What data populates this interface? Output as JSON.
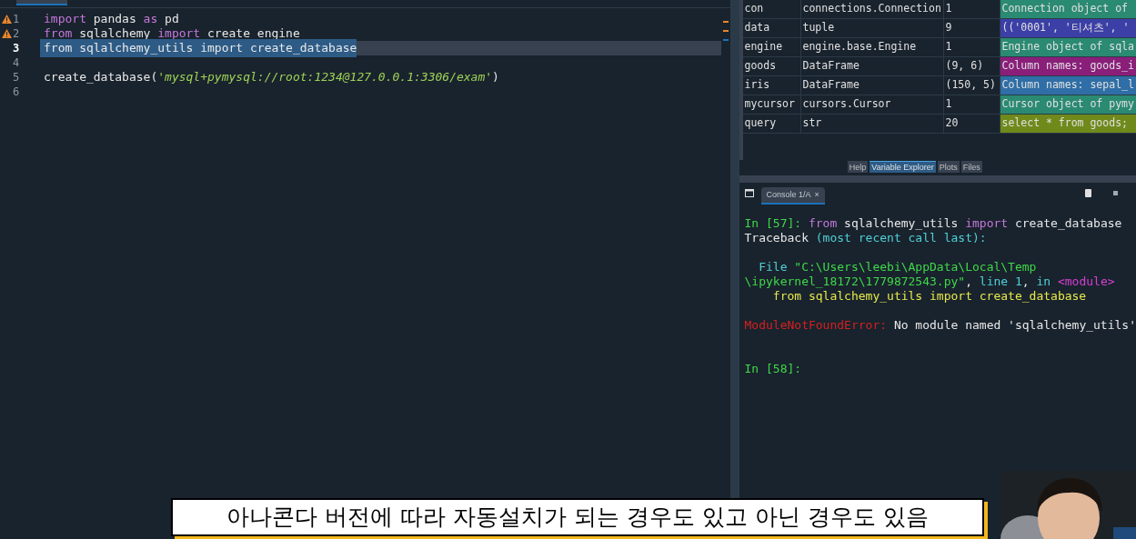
{
  "editor": {
    "lines": [
      {
        "number": "1",
        "warning": true,
        "selected": false,
        "tokens": [
          {
            "kind": "keyword",
            "text": "import"
          },
          {
            "kind": "plain",
            "text": " pandas "
          },
          {
            "kind": "keyword",
            "text": "as"
          },
          {
            "kind": "plain",
            "text": " pd"
          }
        ]
      },
      {
        "number": "2",
        "warning": true,
        "selected": false,
        "tokens": [
          {
            "kind": "keyword",
            "text": "from"
          },
          {
            "kind": "plain",
            "text": " sqlalchemy "
          },
          {
            "kind": "keyword",
            "text": "import"
          },
          {
            "kind": "plain",
            "text": " create_engine"
          }
        ]
      },
      {
        "number": "3",
        "warning": false,
        "selected": true,
        "tokens": [
          {
            "kind": "plain",
            "text": "from sqlalchemy_utils import create_database"
          }
        ]
      },
      {
        "number": "4",
        "warning": false,
        "selected": false
      },
      {
        "number": "5",
        "warning": false,
        "selected": false,
        "tokens": [
          {
            "kind": "plain",
            "text": "create_database("
          },
          {
            "kind": "string",
            "text": "'mysql+pymysql://root:1234@127.0.0.1:3306/exam'"
          },
          {
            "kind": "plain",
            "text": ")"
          }
        ]
      },
      {
        "number": "6",
        "warning": false,
        "selected": false
      }
    ]
  },
  "variables": [
    {
      "name": "con",
      "type": "connections.Connection",
      "size": "1",
      "value": "Connection object of",
      "color": "#2a8a72"
    },
    {
      "name": "data",
      "type": "tuple",
      "size": "9",
      "value": "(('0001', '티셔츠', '",
      "color": "#3b3fa6"
    },
    {
      "name": "engine",
      "type": "engine.base.Engine",
      "size": "1",
      "value": "Engine object of sqla",
      "color": "#2a8a72"
    },
    {
      "name": "goods",
      "type": "DataFrame",
      "size": "(9, 6)",
      "value": "Column names: goods_i",
      "color": "#8a1f7a"
    },
    {
      "name": "iris",
      "type": "DataFrame",
      "size": "(150, 5)",
      "value": "Column names: sepal_l",
      "color": "#2f6ea6"
    },
    {
      "name": "mycursor",
      "type": "cursors.Cursor",
      "size": "1",
      "value": "Cursor object of pymy",
      "color": "#2a8a72"
    },
    {
      "name": "query",
      "type": "str",
      "size": "20",
      "value": "select * from goods;",
      "color": "#6f8a1a"
    }
  ],
  "pane_tabs": [
    {
      "label": "Help",
      "selected": false
    },
    {
      "label": "Variable Explorer",
      "selected": true
    },
    {
      "label": "Plots",
      "selected": false
    },
    {
      "label": "Files",
      "selected": false
    }
  ],
  "console": {
    "tab": "Console 1/A",
    "close": "×",
    "lines": [
      {
        "kind": "text",
        "tokens": [
          {
            "kind": "prompt",
            "text": "In [57]: "
          },
          {
            "kind": "keyword",
            "text": "from"
          },
          {
            "kind": "plain",
            "text": " sqlalchemy_utils "
          },
          {
            "kind": "keyword",
            "text": "import"
          },
          {
            "kind": "plain",
            "text": " create_database"
          }
        ]
      },
      {
        "kind": "text",
        "tokens": [
          {
            "kind": "plain",
            "text": "Traceback "
          },
          {
            "kind": "cyan",
            "text": "(most recent call last):"
          }
        ]
      },
      {
        "kind": "blank"
      },
      {
        "kind": "text",
        "tokens": [
          {
            "kind": "cyan",
            "text": "  File "
          },
          {
            "kind": "green",
            "text": "\"C:\\Users\\leebi\\AppData\\Local\\Temp"
          }
        ]
      },
      {
        "kind": "text",
        "tokens": [
          {
            "kind": "green",
            "text": "\\ipykernel_18172\\1779872543.py\""
          },
          {
            "kind": "plain",
            "text": ", "
          },
          {
            "kind": "cyan",
            "text": "line 1"
          },
          {
            "kind": "plain",
            "text": ", "
          },
          {
            "kind": "cyan",
            "text": "in "
          },
          {
            "kind": "magenta",
            "text": "<module>"
          }
        ]
      },
      {
        "kind": "text",
        "tokens": [
          {
            "kind": "yellow",
            "text": "    from sqlalchemy_utils import create_database"
          }
        ]
      },
      {
        "kind": "blank"
      },
      {
        "kind": "text",
        "tokens": [
          {
            "kind": "error",
            "text": "ModuleNotFoundError:"
          },
          {
            "kind": "plain",
            "text": " No module named 'sqlalchemy_utils'"
          }
        ]
      },
      {
        "kind": "blank"
      },
      {
        "kind": "blank"
      },
      {
        "kind": "text",
        "tokens": [
          {
            "kind": "prompt",
            "text": "In [58]:"
          }
        ]
      }
    ]
  },
  "subtitle": "아나콘다 버전에 따라 자동설치가 되는 경우도 있고 아닌 경우도 있음"
}
